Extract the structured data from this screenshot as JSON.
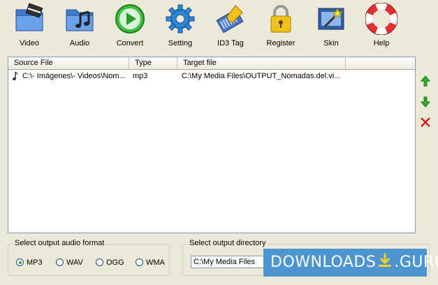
{
  "toolbar": {
    "video": "Video",
    "audio": "Audio",
    "convert": "Convert",
    "setting": "Setting",
    "id3tag": "ID3 Tag",
    "register": "Register",
    "skin": "Skin",
    "help": "Help"
  },
  "list": {
    "columns": [
      "Source File",
      "Type",
      "Target file"
    ],
    "rows": [
      {
        "source": "C:\\- Imágenes\\- Videos\\Nom...",
        "type": "mp3",
        "target": "C:\\My Media Files\\OUTPUT_Nomadas.del.vi..."
      }
    ]
  },
  "side": {
    "icons": [
      "arrow-up-icon",
      "arrow-down-icon",
      "delete-icon"
    ]
  },
  "format": {
    "title": "Select output audio format",
    "options": [
      "MP3",
      "WAV",
      "OGG",
      "WMA"
    ],
    "selected": "MP3"
  },
  "directory": {
    "title": "Select output directory",
    "value": "C:\\My Media Files"
  },
  "watermark": {
    "left": "DOWNLOADS",
    "right": ".GURU"
  },
  "colors": {
    "accent_green": "#21a121",
    "watermark_blue": "#4d95d1",
    "delete_red": "#d02020"
  }
}
